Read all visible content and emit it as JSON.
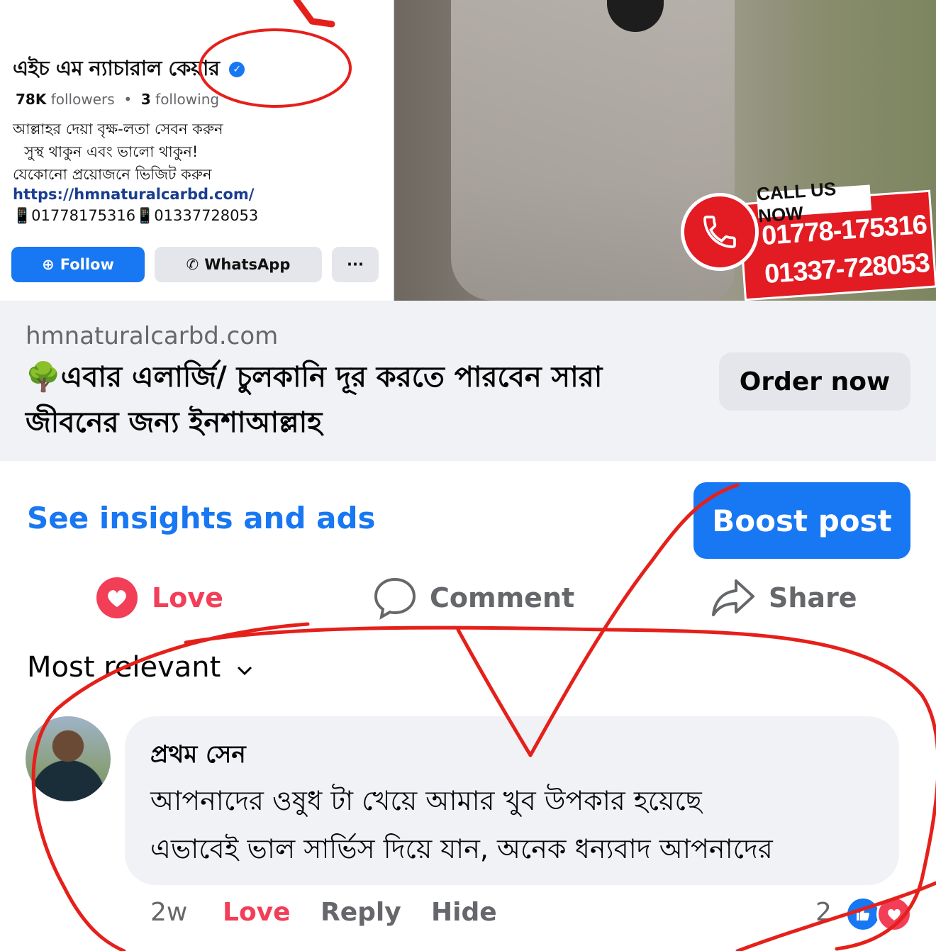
{
  "ad_image": {
    "page_name": "এইচ এম ন্যাচারাল কেয়ার",
    "followers": "78K",
    "followers_label": "followers",
    "following": "3",
    "following_label": "following",
    "bio_lines": [
      "আল্লাহর দেয়া বৃক্ষ-লতা সেবন করুন",
      "সুস্থ থাকুন এবং ভালো থাকুন!",
      "যেকোনো প্রয়োজনে ভিজিট করুন"
    ],
    "bio_link": "https://hmnaturalcarbd.com/",
    "bio_phones": "📱01778175316📱01337728053",
    "follow_label": "Follow",
    "whatsapp_label": "WhatsApp",
    "more_label": "···",
    "call_title": "CALL US NOW",
    "call_numbers": [
      "01778-175316",
      "01337-728053"
    ]
  },
  "link_preview": {
    "domain": "hmnaturalcarbd.com",
    "title": "🌳এবার এলার্জি/ চুলকানি দূর করতে পারবেন সারা জীবনের জন্য ইনশাআল্লাহ",
    "cta_label": "Order now"
  },
  "insights_label": "See insights and ads",
  "boost_label": "Boost post",
  "actions": {
    "love": "Love",
    "comment": "Comment",
    "share": "Share"
  },
  "sort_label": "Most relevant",
  "comment": {
    "author": "প্রথম সেন",
    "lines": [
      "আপনাদের ওষুধ টা খেয়ে আমার খুব উপকার হয়েছে",
      "এভাবেই ভাল সার্ভিস দিয়ে যান, অনেক ধন্যবাদ আপনাদের"
    ],
    "time": "2w",
    "love_label": "Love",
    "reply_label": "Reply",
    "hide_label": "Hide",
    "reaction_count": "2"
  },
  "colors": {
    "facebook_blue": "#1877f2",
    "love_red": "#f33e58",
    "secondary_text": "#65676b",
    "annotation_red": "#e5201b"
  }
}
